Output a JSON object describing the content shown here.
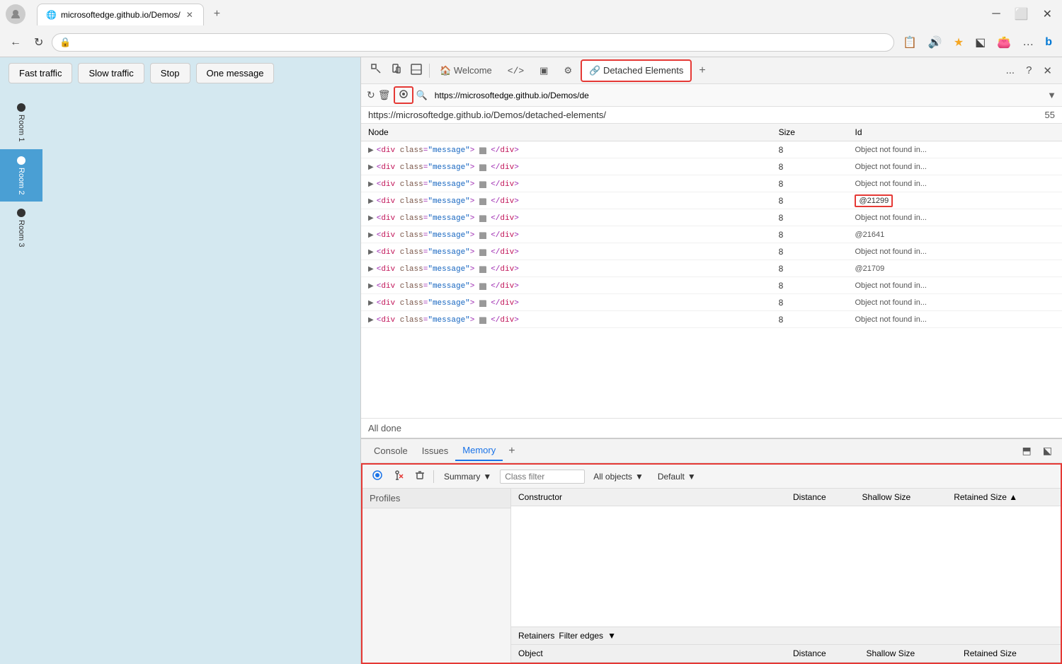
{
  "browser": {
    "tab_title": "microsoftedge.github.io/Demos/",
    "url": "https://microsoftedge.github.io/Demos/detached-elements/",
    "url_short": "https://microsoftedge.github.io/Demos/de",
    "new_tab_plus": "+"
  },
  "webpage": {
    "fast_traffic_btn": "Fast traffic",
    "slow_traffic_btn": "Slow traffic",
    "stop_btn": "Stop",
    "one_message_btn": "One message",
    "rooms": [
      {
        "id": "room1",
        "label": "Room 1",
        "active": false
      },
      {
        "id": "room2",
        "label": "Room 2",
        "active": true
      },
      {
        "id": "room3",
        "label": "Room 3",
        "active": false
      }
    ]
  },
  "devtools": {
    "toolbar_tabs": [
      {
        "id": "welcome",
        "label": "Welcome",
        "icon": "🏠"
      },
      {
        "id": "elements",
        "label": "",
        "icon": "</>"
      },
      {
        "id": "console",
        "label": "",
        "icon": "▣"
      },
      {
        "id": "devtools-extra",
        "label": "",
        "icon": "⚙"
      },
      {
        "id": "detached-elements",
        "label": "Detached Elements",
        "icon": "🔗",
        "highlighted": true
      }
    ],
    "toolbar_more": "...",
    "toolbar_help": "?",
    "toolbar_close": "✕",
    "search_icon": "🔍",
    "search_url": "https://microsoftedge.github.io/Demos/de",
    "detached_url": "https://microsoftedge.github.io/Demos/detached-elements/",
    "count": "55",
    "table_headers": [
      "Node",
      "Size",
      "Id"
    ],
    "rows": [
      {
        "node": "<div class=\"message\"> ⬛⬛ </div>",
        "size": "8",
        "id": "Object not found in..."
      },
      {
        "node": "<div class=\"message\"> ⬛⬛ </div>",
        "size": "8",
        "id": "Object not found in..."
      },
      {
        "node": "<div class=\"message\"> ⬛⬛ </div>",
        "size": "8",
        "id": "Object not found in..."
      },
      {
        "node": "<div class=\"message\"> ⬛⬛ </div>",
        "size": "8",
        "id": "@21299",
        "highlight": true
      },
      {
        "node": "<div class=\"message\"> ⬛⬛ </div>",
        "size": "8",
        "id": "Object not found in..."
      },
      {
        "node": "<div class=\"message\"> ⬛⬛ </div>",
        "size": "8",
        "id": "@21641"
      },
      {
        "node": "<div class=\"message\"> ⬛⬛ </div>",
        "size": "8",
        "id": "Object not found in..."
      },
      {
        "node": "<div class=\"message\"> ⬛⬛ </div>",
        "size": "8",
        "id": "@21709"
      },
      {
        "node": "<div class=\"message\"> ⬛⬛ </div>",
        "size": "8",
        "id": "Object not found in..."
      },
      {
        "node": "<div class=\"message\"> ⬛⬛ </div>",
        "size": "8",
        "id": "Object not found in..."
      },
      {
        "node": "<div class=\"message\"> ⬛⬛ </div>",
        "size": "8",
        "id": "Object not found in..."
      }
    ],
    "all_done": "All done"
  },
  "bottom_panel": {
    "tabs": [
      "Console",
      "Issues",
      "Memory"
    ],
    "active_tab": "Memory",
    "memory": {
      "summary_label": "Summary",
      "class_filter_placeholder": "Class filter",
      "all_objects_label": "All objects",
      "default_label": "Default",
      "profiles_label": "Profiles",
      "heap_headers": [
        "Constructor",
        "Distance",
        "Shallow Size",
        "Retained Size"
      ],
      "retainers_label": "Retainers",
      "filter_edges_label": "Filter edges",
      "object_headers": [
        "Object",
        "Distance",
        "Shallow Size",
        "Retained Size"
      ]
    }
  }
}
